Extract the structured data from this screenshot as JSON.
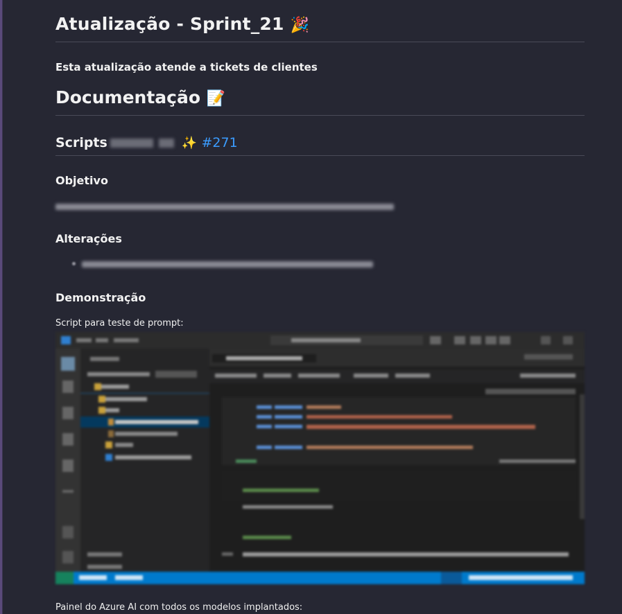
{
  "page": {
    "title": "Atualização - Sprint_21",
    "title_emoji": "🎉",
    "lead": "Esta atualização atende a tickets de clientes",
    "doc_heading": "Documentação",
    "doc_emoji": "📝",
    "section_title": "Scripts",
    "section_emoji": "✨",
    "ticket_link": "#271",
    "objective_heading": "Objetivo",
    "changes_heading": "Alterações",
    "demo_heading": "Demonstração",
    "caption_prompt": "Script para teste de prompt:",
    "caption_azure": "Painel do Azure AI com todos os modelos implantados:"
  },
  "colors": {
    "background": "#262733",
    "link": "#3b9cff",
    "statusbar": "#007acc"
  }
}
